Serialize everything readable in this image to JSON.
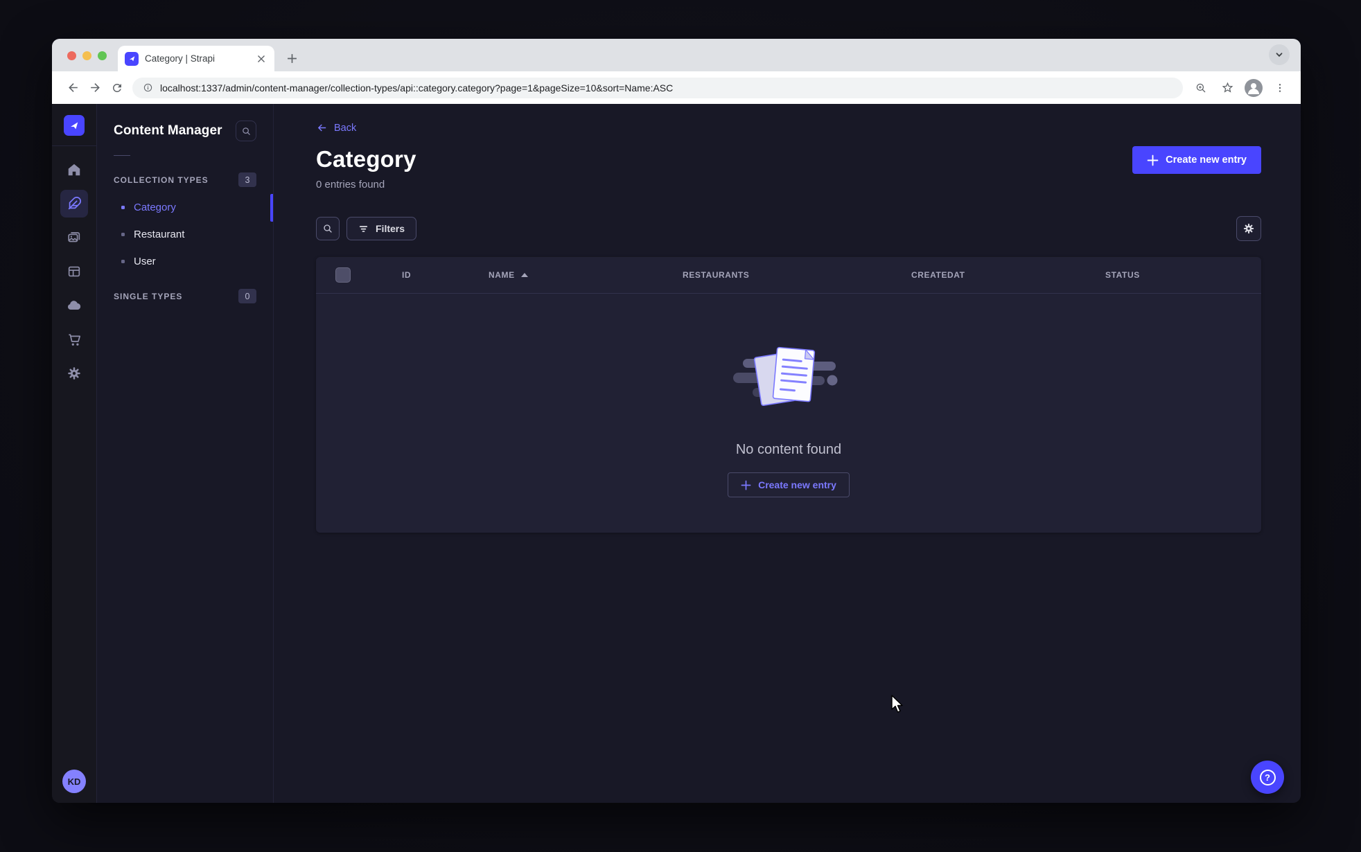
{
  "browser": {
    "tab_title": "Category | Strapi",
    "url": "localhost:1337/admin/content-manager/collection-types/api::category.category?page=1&pageSize=10&sort=Name:ASC"
  },
  "sidebar": {
    "user_initials": "KD"
  },
  "subnav": {
    "title": "Content Manager",
    "collection_types": {
      "label": "COLLECTION TYPES",
      "badge": "3",
      "items": [
        {
          "label": "Category",
          "active": true
        },
        {
          "label": "Restaurant",
          "active": false
        },
        {
          "label": "User",
          "active": false
        }
      ]
    },
    "single_types": {
      "label": "SINGLE TYPES",
      "badge": "0"
    }
  },
  "main": {
    "back_label": "Back",
    "title": "Category",
    "entries_found": "0 entries found",
    "create_button_label": "Create new entry",
    "filters_label": "Filters",
    "table": {
      "columns": [
        "ID",
        "NAME",
        "RESTAURANTS",
        "CREATEDAT",
        "STATUS"
      ],
      "sorted_by": "NAME",
      "sort_direction": "ASC"
    },
    "empty_state": {
      "message": "No content found",
      "create_button_label": "Create new entry"
    }
  },
  "help_icon": "?",
  "colors": {
    "accent": "#4945ff",
    "accent_light": "#7b79ff",
    "app_bg": "#181826",
    "card_bg": "#212134",
    "border": "#32324d",
    "text_muted": "#a5a5ba"
  }
}
